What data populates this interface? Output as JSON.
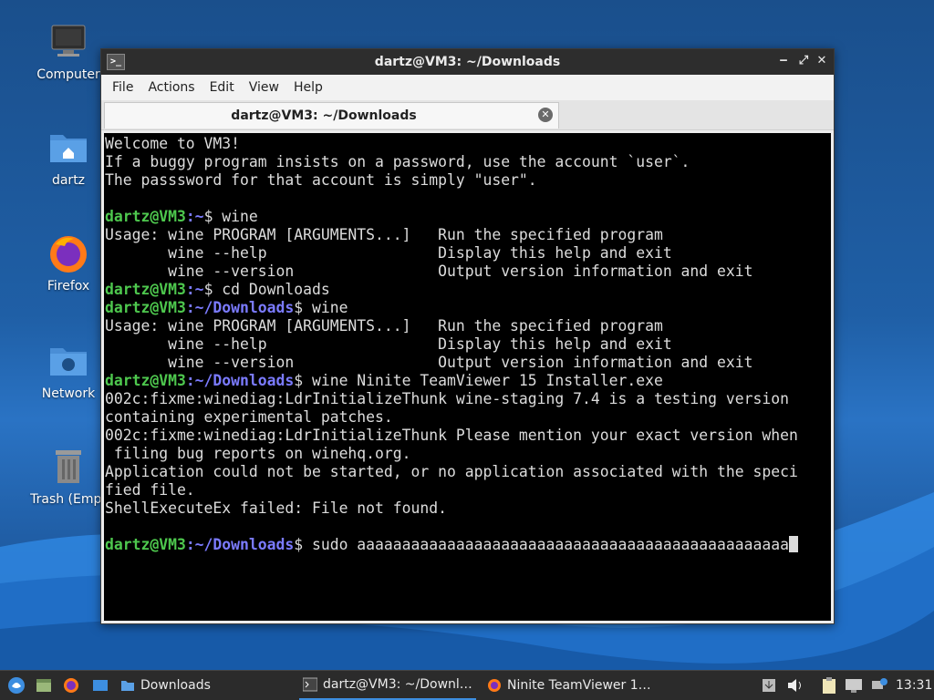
{
  "desktop": {
    "icons": [
      {
        "label": "Computer",
        "icon": "computer-icon"
      },
      {
        "label": "dartz",
        "icon": "home-folder-icon"
      },
      {
        "label": "Firefox",
        "icon": "firefox-icon"
      },
      {
        "label": "Network",
        "icon": "network-folder-icon"
      },
      {
        "label": "Trash (Empt",
        "icon": "trash-icon"
      }
    ]
  },
  "window": {
    "title": "dartz@VM3: ~/Downloads",
    "menu": [
      "File",
      "Actions",
      "Edit",
      "View",
      "Help"
    ],
    "tab_label": "dartz@VM3: ~/Downloads",
    "controls": {
      "minimize": "‒",
      "maximize": "⤢",
      "close": "✕"
    }
  },
  "terminal": {
    "prompt_user": "dartz@VM3",
    "lines": [
      {
        "t": "Welcome to VM3!"
      },
      {
        "t": "If a buggy program insists on a password, use the account `user`."
      },
      {
        "t": "The passsword for that account is simply \"user\"."
      },
      {
        "t": ""
      },
      {
        "u": "dartz@VM3",
        "p": ":~",
        "t": "$ wine"
      },
      {
        "t": "Usage: wine PROGRAM [ARGUMENTS...]   Run the specified program"
      },
      {
        "t": "       wine --help                   Display this help and exit"
      },
      {
        "t": "       wine --version                Output version information and exit"
      },
      {
        "u": "dartz@VM3",
        "p": ":~",
        "t": "$ cd Downloads"
      },
      {
        "u": "dartz@VM3",
        "p": ":~/Downloads",
        "t": "$ wine"
      },
      {
        "t": "Usage: wine PROGRAM [ARGUMENTS...]   Run the specified program"
      },
      {
        "t": "       wine --help                   Display this help and exit"
      },
      {
        "t": "       wine --version                Output version information and exit"
      },
      {
        "u": "dartz@VM3",
        "p": ":~/Downloads",
        "t": "$ wine Ninite TeamViewer 15 Installer.exe"
      },
      {
        "t": "002c:fixme:winediag:LdrInitializeThunk wine-staging 7.4 is a testing version"
      },
      {
        "t": "containing experimental patches."
      },
      {
        "t": "002c:fixme:winediag:LdrInitializeThunk Please mention your exact version when"
      },
      {
        "t": " filing bug reports on winehq.org."
      },
      {
        "t": "Application could not be started, or no application associated with the speci"
      },
      {
        "t": "fied file."
      },
      {
        "t": "ShellExecuteEx failed: File not found."
      },
      {
        "t": ""
      },
      {
        "u": "dartz@VM3",
        "p": ":~/Downloads",
        "t": "$ sudo aaaaaaaaaaaaaaaaaaaaaaaaaaaaaaaaaaaaaaaaaaaaaaaa",
        "cursor": true
      }
    ]
  },
  "taskbar": {
    "launchers": [
      "whisker-menu-icon",
      "file-manager-icon",
      "firefox-icon",
      "show-desktop-icon"
    ],
    "tasks": [
      {
        "label": "Downloads",
        "icon": "folder-icon"
      },
      {
        "label": "dartz@VM3: ~/Downl…",
        "icon": "terminal-icon",
        "active": true
      },
      {
        "label": "Ninite TeamViewer 1…",
        "icon": "firefox-icon"
      }
    ],
    "tray": [
      "updates-icon",
      "volume-icon",
      "clipboard-icon",
      "display-icon",
      "network-icon"
    ],
    "clock": "13:31"
  },
  "colors": {
    "prompt_user": "#4ec84e",
    "prompt_path": "#7b7bff",
    "terminal_bg": "#000000",
    "taskbar_bg": "#2b2b2b"
  }
}
